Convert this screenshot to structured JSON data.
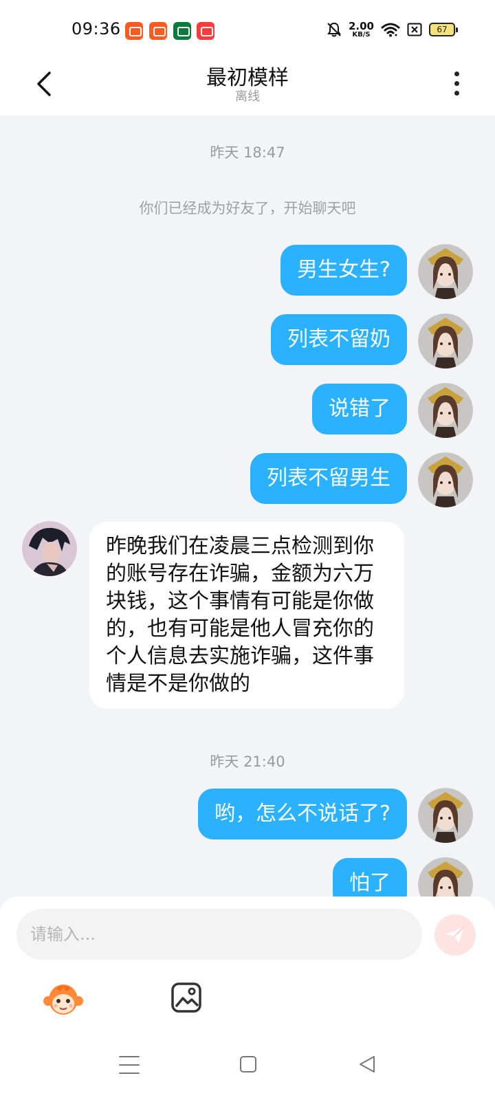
{
  "status_bar": {
    "time": "09:36",
    "net_speed_value": "2.00",
    "net_speed_unit": "KB/S",
    "battery": "67",
    "icons": [
      "app-icon-kuaishou",
      "app-icon-kuaishou",
      "app-icon-oppo",
      "app-icon-video",
      "bell-mute-icon",
      "wifi-icon",
      "sim-off-icon",
      "battery-icon"
    ]
  },
  "header": {
    "title": "最初模样",
    "subtitle": "离线",
    "back_icon": "chevron-left-icon",
    "more_icon": "more-vertical-icon"
  },
  "chat": {
    "timestamps": [
      "昨天 18:47",
      "昨天 21:40"
    ],
    "system_message": "你们已经成为好友了，开始聊天吧",
    "messages": [
      {
        "from": "me",
        "text": "男生女生?"
      },
      {
        "from": "me",
        "text": "列表不留奶"
      },
      {
        "from": "me",
        "text": "说错了"
      },
      {
        "from": "me",
        "text": "列表不留男生"
      },
      {
        "from": "other",
        "text": "昨晚我们在凌晨三点检测到你的账号存在诈骗，金额为六万块钱，这个事情有可能是你做的，也有可能是他人冒充你的个人信息去实施诈骗，这件事情是不是你做的"
      },
      {
        "from": "me",
        "text": "哟，怎么不说话了?"
      },
      {
        "from": "me",
        "text": "怕了"
      }
    ]
  },
  "input": {
    "placeholder": "请输入...",
    "value": ""
  },
  "colors": {
    "accent": "#2ab1ff",
    "background": "#f2f4f7",
    "send_button": "#ffe3e3"
  }
}
